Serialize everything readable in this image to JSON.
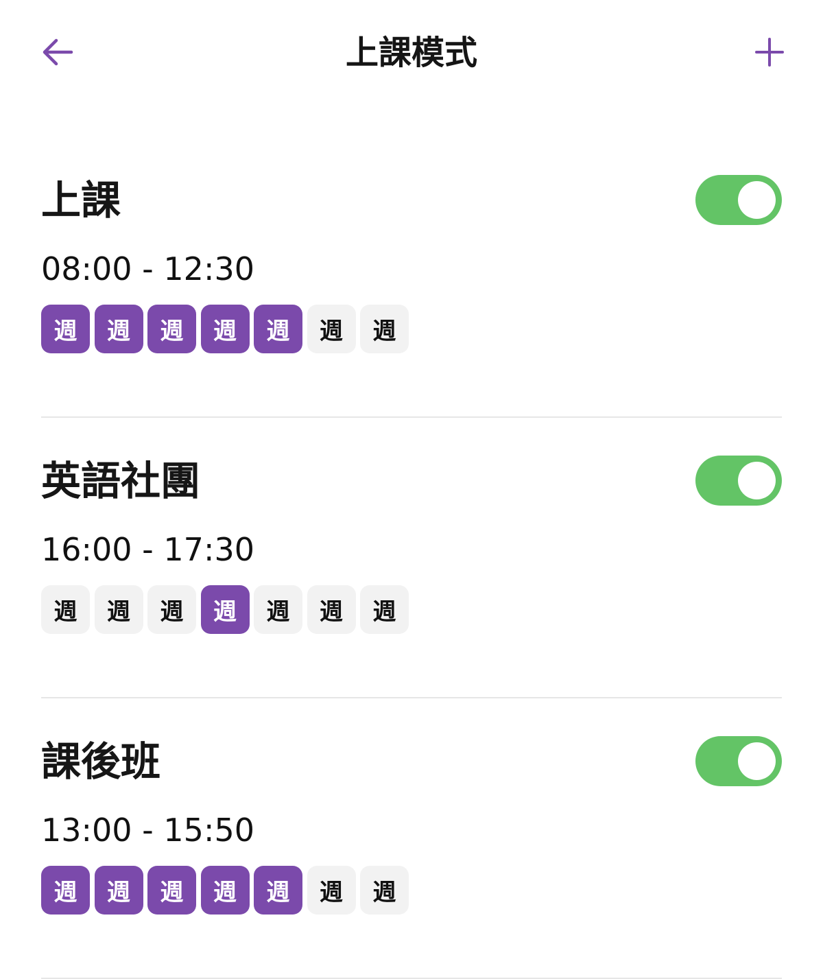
{
  "header": {
    "title": "上課模式",
    "back_icon": "arrow-left-icon",
    "add_icon": "plus-icon"
  },
  "colors": {
    "accent": "#7b4aab",
    "toggle_on": "#63c466",
    "chip_off": "#f2f2f2",
    "divider": "#e6e6e6"
  },
  "modes": [
    {
      "name": "上課",
      "time": "08:00 - 12:30",
      "enabled": true,
      "days": [
        {
          "label": "週",
          "selected": true
        },
        {
          "label": "週",
          "selected": true
        },
        {
          "label": "週",
          "selected": true
        },
        {
          "label": "週",
          "selected": true
        },
        {
          "label": "週",
          "selected": true
        },
        {
          "label": "週",
          "selected": false
        },
        {
          "label": "週",
          "selected": false
        }
      ]
    },
    {
      "name": "英語社團",
      "time": "16:00 - 17:30",
      "enabled": true,
      "days": [
        {
          "label": "週",
          "selected": false
        },
        {
          "label": "週",
          "selected": false
        },
        {
          "label": "週",
          "selected": false
        },
        {
          "label": "週",
          "selected": true
        },
        {
          "label": "週",
          "selected": false
        },
        {
          "label": "週",
          "selected": false
        },
        {
          "label": "週",
          "selected": false
        }
      ]
    },
    {
      "name": "課後班",
      "time": "13:00 - 15:50",
      "enabled": true,
      "days": [
        {
          "label": "週",
          "selected": true
        },
        {
          "label": "週",
          "selected": true
        },
        {
          "label": "週",
          "selected": true
        },
        {
          "label": "週",
          "selected": true
        },
        {
          "label": "週",
          "selected": true
        },
        {
          "label": "週",
          "selected": false
        },
        {
          "label": "週",
          "selected": false
        }
      ]
    }
  ]
}
